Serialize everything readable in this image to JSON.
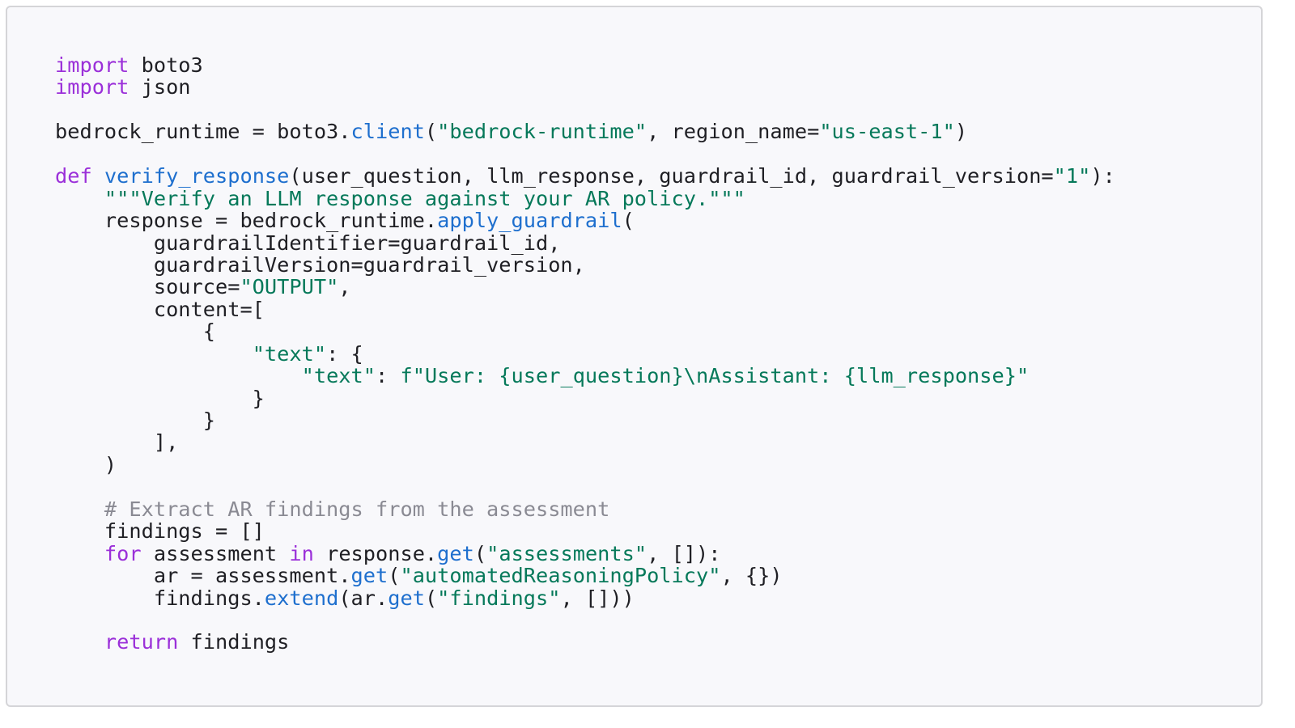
{
  "code": {
    "language": "python",
    "colors": {
      "background": "#f8f8fb",
      "border": "#d5d5d8",
      "keyword": "#9b30d9",
      "function": "#1e6fce",
      "string": "#06795a",
      "comment": "#8a8a93",
      "plain": "#1f1f24"
    },
    "lines": [
      [
        [
          "kw",
          "import"
        ],
        [
          "plain",
          " boto3"
        ]
      ],
      [
        [
          "kw",
          "import"
        ],
        [
          "plain",
          " json"
        ]
      ],
      [],
      [
        [
          "plain",
          "bedrock_runtime = boto3."
        ],
        [
          "fn",
          "client"
        ],
        [
          "plain",
          "("
        ],
        [
          "str",
          "\"bedrock-runtime\""
        ],
        [
          "plain",
          ", region_name="
        ],
        [
          "str",
          "\"us-east-1\""
        ],
        [
          "plain",
          ")"
        ]
      ],
      [],
      [
        [
          "kw",
          "def"
        ],
        [
          "plain",
          " "
        ],
        [
          "fn",
          "verify_response"
        ],
        [
          "plain",
          "(user_question, llm_response, guardrail_id, guardrail_version="
        ],
        [
          "str",
          "\"1\""
        ],
        [
          "plain",
          "):"
        ]
      ],
      [
        [
          "plain",
          "    "
        ],
        [
          "str",
          "\"\"\"Verify an LLM response against your AR policy.\"\"\""
        ]
      ],
      [
        [
          "plain",
          "    response = bedrock_runtime."
        ],
        [
          "fn",
          "apply_guardrail"
        ],
        [
          "plain",
          "("
        ]
      ],
      [
        [
          "plain",
          "        guardrailIdentifier=guardrail_id,"
        ]
      ],
      [
        [
          "plain",
          "        guardrailVersion=guardrail_version,"
        ]
      ],
      [
        [
          "plain",
          "        source="
        ],
        [
          "str",
          "\"OUTPUT\""
        ],
        [
          "plain",
          ","
        ]
      ],
      [
        [
          "plain",
          "        content=["
        ]
      ],
      [
        [
          "plain",
          "            {"
        ]
      ],
      [
        [
          "plain",
          "                "
        ],
        [
          "str",
          "\"text\""
        ],
        [
          "plain",
          ": {"
        ]
      ],
      [
        [
          "plain",
          "                    "
        ],
        [
          "str",
          "\"text\""
        ],
        [
          "plain",
          ": "
        ],
        [
          "str",
          "f\"User: {user_question}\\nAssistant: {llm_response}\""
        ]
      ],
      [
        [
          "plain",
          "                }"
        ]
      ],
      [
        [
          "plain",
          "            }"
        ]
      ],
      [
        [
          "plain",
          "        ],"
        ]
      ],
      [
        [
          "plain",
          "    )"
        ]
      ],
      [],
      [
        [
          "plain",
          "    "
        ],
        [
          "cm",
          "# Extract AR findings from the assessment"
        ]
      ],
      [
        [
          "plain",
          "    findings = []"
        ]
      ],
      [
        [
          "plain",
          "    "
        ],
        [
          "kw",
          "for"
        ],
        [
          "plain",
          " assessment "
        ],
        [
          "kw",
          "in"
        ],
        [
          "plain",
          " response."
        ],
        [
          "fn",
          "get"
        ],
        [
          "plain",
          "("
        ],
        [
          "str",
          "\"assessments\""
        ],
        [
          "plain",
          ", []):"
        ]
      ],
      [
        [
          "plain",
          "        ar = assessment."
        ],
        [
          "fn",
          "get"
        ],
        [
          "plain",
          "("
        ],
        [
          "str",
          "\"automatedReasoningPolicy\""
        ],
        [
          "plain",
          ", {})"
        ]
      ],
      [
        [
          "plain",
          "        findings."
        ],
        [
          "fn",
          "extend"
        ],
        [
          "plain",
          "(ar."
        ],
        [
          "fn",
          "get"
        ],
        [
          "plain",
          "("
        ],
        [
          "str",
          "\"findings\""
        ],
        [
          "plain",
          ", []))"
        ]
      ],
      [],
      [
        [
          "plain",
          "    "
        ],
        [
          "kw",
          "return"
        ],
        [
          "plain",
          " findings"
        ]
      ]
    ]
  }
}
